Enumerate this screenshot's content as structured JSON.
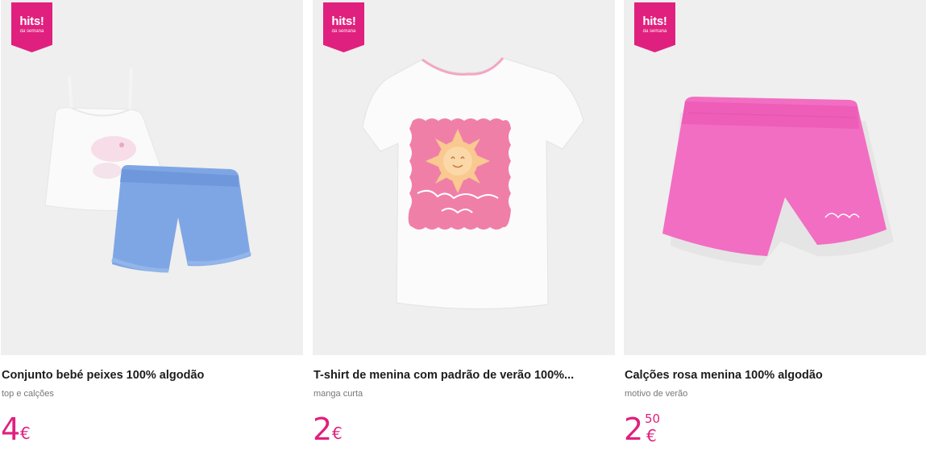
{
  "badge": {
    "main": "hits!",
    "sub": "da semana"
  },
  "products": [
    {
      "title": "Conjunto bebé peixes 100% algodão",
      "subtitle": "top e calções",
      "price_int": "4",
      "price_dec": "",
      "currency": "€"
    },
    {
      "title": "T-shirt de menina com padrão de verão 100%...",
      "subtitle": "manga curta",
      "price_int": "2",
      "price_dec": "",
      "currency": "€"
    },
    {
      "title": "Calções rosa menina 100% algodão",
      "subtitle": "motivo de verão",
      "price_int": "2",
      "price_dec": "50",
      "currency": "€"
    }
  ],
  "colors": {
    "accent": "#e0207e",
    "image_bg": "#efefef",
    "title": "#1c1c1c",
    "subtitle": "#777777"
  }
}
